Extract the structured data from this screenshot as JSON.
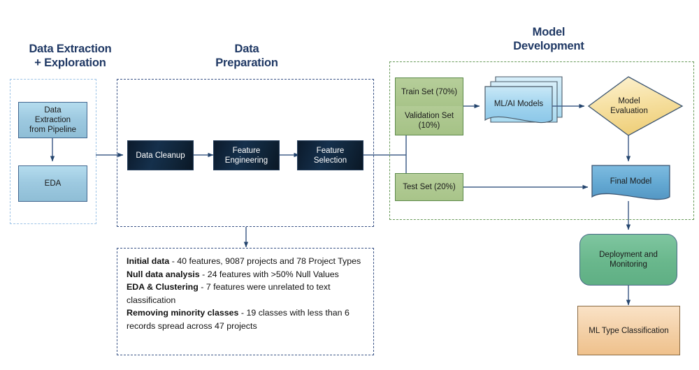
{
  "sections": [
    {
      "id": "data-extraction",
      "title": "Data Extraction\n+ Exploration",
      "border_color": "#9DC3E6"
    },
    {
      "id": "data-preparation",
      "title": "Data\nPreparation",
      "border_color": "#3B5486"
    },
    {
      "id": "model-development",
      "title": "Model\nDevelopment",
      "border_color": "#6A9B5B"
    }
  ],
  "nodes": {
    "data_extraction_from_pipeline": "Data\nExtraction\nfrom Pipeline",
    "eda": "EDA",
    "data_cleanup": "Data Cleanup",
    "feature_engineering": "Feature\nEngineering",
    "feature_selection": "Feature\nSelection",
    "train_set": "Train Set (70%)",
    "validation_set": "Validation Set\n(10%)",
    "test_set": "Test Set (20%)",
    "ml_ai_models": "ML/AI Models",
    "model_evaluation": "Model\nEvaluation",
    "final_model": "Final Model",
    "deployment_and_monitoring": "Deployment and\nMonitoring",
    "ml_type_classification": "ML Type Classification"
  },
  "findings": [
    {
      "label": "Initial data",
      "text": " - 40 features, 9087 projects and 78 Project Types"
    },
    {
      "label": "Null data analysis",
      "text": " - 24 features with >50% Null Values"
    },
    {
      "label": "EDA & Clustering",
      "text": " - 7 features were unrelated to text classification"
    },
    {
      "label": "Removing minority classes",
      "text": " - 19 classes with less than 6 records spread across 47 projects"
    }
  ],
  "colors": {
    "title_text": "#1F3864",
    "connector": "#44618A",
    "node_blue": "#9DC9E0",
    "node_dark": "#15304C",
    "node_green": "#A8C489",
    "node_yellow": "#F5DFA0",
    "node_deploy_green": "#69B78C",
    "node_orange": "#F3CFA5"
  }
}
